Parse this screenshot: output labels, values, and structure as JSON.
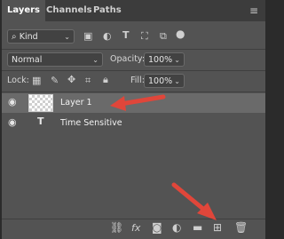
{
  "tabs": [
    {
      "label": "Layers"
    },
    {
      "label": "Channels"
    },
    {
      "label": "Paths"
    }
  ],
  "filter": {
    "kind_label": "Kind"
  },
  "blend": {
    "mode": "Normal",
    "opacity_label": "Opacity:",
    "opacity_value": "100%"
  },
  "locks": {
    "lock_label": "Lock:",
    "fill_label": "Fill:",
    "fill_value": "100%"
  },
  "layers": [
    {
      "name": "Layer 1"
    },
    {
      "name": "Time Sensitive"
    }
  ],
  "colors": {
    "panel": "#535353",
    "tabbar": "#3c3c3c",
    "selected_row": "#6a6a6a",
    "arrow": "#e0463a"
  }
}
